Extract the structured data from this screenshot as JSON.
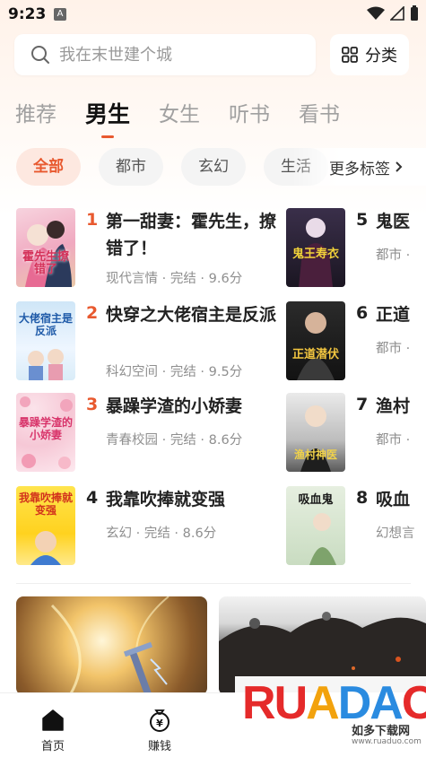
{
  "status_bar": {
    "time": "9:23",
    "app_icon_letter": "A"
  },
  "search": {
    "placeholder": "我在末世建个城"
  },
  "category_button": {
    "label": "分类"
  },
  "tabs": [
    {
      "label": "推荐",
      "active": false
    },
    {
      "label": "男生",
      "active": true
    },
    {
      "label": "女生",
      "active": false
    },
    {
      "label": "听书",
      "active": false
    },
    {
      "label": "看书",
      "active": false
    }
  ],
  "chips": [
    {
      "label": "全部",
      "active": true
    },
    {
      "label": "都市",
      "active": false
    },
    {
      "label": "玄幻",
      "active": false
    },
    {
      "label": "生活",
      "active": false
    }
  ],
  "more_tags": {
    "label": "更多标签"
  },
  "books_left": [
    {
      "rank": "1",
      "title": "第一甜妻：霍先生，撩错了！",
      "meta": "现代言情 · 完结 · 9.6分",
      "cover_text": "霍先生撩错了"
    },
    {
      "rank": "2",
      "title": "快穿之大佬宿主是反派",
      "meta": "科幻空间 · 完结 · 9.5分",
      "cover_text": "大佬宿主是反派"
    },
    {
      "rank": "3",
      "title": "暴躁学渣的小娇妻",
      "meta": "青春校园 · 完结 · 8.6分",
      "cover_text": "暴躁学渣的小娇妻"
    },
    {
      "rank": "4",
      "title": "我靠吹捧就变强",
      "meta": "玄幻 · 完结 · 8.6分",
      "cover_text": "我靠吹捧就变强"
    }
  ],
  "books_right": [
    {
      "rank": "5",
      "title": "鬼医",
      "meta": "都市 ·",
      "cover_text": "鬼王寿衣"
    },
    {
      "rank": "6",
      "title": "正道",
      "meta": "都市 ·",
      "cover_text": "正道潜伏"
    },
    {
      "rank": "7",
      "title": "渔村",
      "meta": "都市 ·",
      "cover_text": "渔村神医"
    },
    {
      "rank": "8",
      "title": "吸血",
      "meta": "幻想言",
      "cover_text": "吸血鬼"
    }
  ],
  "bottom_nav": [
    {
      "label": "首页",
      "active": true
    },
    {
      "label": "赚钱",
      "active": false
    }
  ],
  "watermark": {
    "logo_letters": [
      "R",
      "U",
      "A",
      "D",
      "A",
      "O"
    ],
    "name": "如多下载网",
    "url": "www.ruaduo.com"
  },
  "colors": {
    "accent": "#e8592f",
    "rank_top": "#e8592f"
  }
}
